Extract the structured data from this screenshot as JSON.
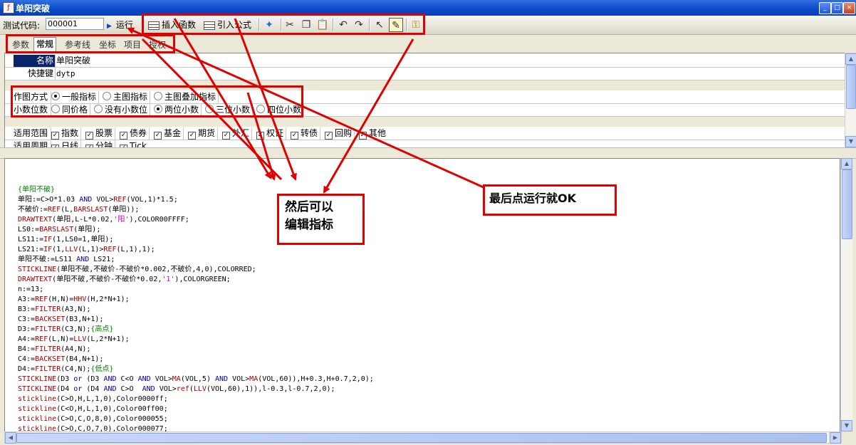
{
  "window": {
    "title": "单阳突破",
    "app_icon": "formula-icon"
  },
  "toolbar": {
    "test_code_label": "测试代码:",
    "test_code_value": "000001",
    "run_label": "运行",
    "insert_function_label": "插入函数",
    "import_formula_label": "引入公式"
  },
  "tabs": [
    "参数",
    "常规",
    "参考线",
    "坐标",
    "项目",
    "授权"
  ],
  "active_tab": "常规",
  "props": {
    "name_key": "名称",
    "name_value": "单阳突破",
    "shortcut_key": "快捷键",
    "shortcut_value": "dytp",
    "draw_mode_key": "作图方式",
    "draw_modes": [
      "一般指标",
      "主图指标",
      "主图叠加指标"
    ],
    "draw_mode_selected": "一般指标",
    "decimals_key": "小数位数",
    "decimals": [
      "同价格",
      "没有小数位",
      "两位小数",
      "三位小数",
      "四位小数"
    ],
    "decimals_selected": "两位小数",
    "scope_key": "适用范围",
    "scope_items": [
      "指数",
      "股票",
      "债券",
      "基金",
      "期货",
      "外汇",
      "权证",
      "转债",
      "回购",
      "其他"
    ],
    "period_key": "适用周期",
    "period_items": [
      "日线",
      "分钟",
      "Tick"
    ]
  },
  "code": [
    "{单阳不破}",
    "单阳:=C>O*1.03 AND VOL>REF(VOL,1)*1.5;",
    "不破价:=REF(L,BARSLAST(单阳));",
    "DRAWTEXT(单阳,L-L*0.02,'阳'),COLOR00FFFF;",
    "LS0:=BARSLAST(单阳);",
    "LS11:=IF(1,LS0=1,单阳);",
    "LS21:=IF(1,LLV(L,1)>REF(L,1),1);",
    "单阳不破:=LS11 AND LS21;",
    "STICKLINE(单阳不破,不破价-不破价*0.002,不破价,4,0),COLORRED;",
    "DRAWTEXT(单阳不破,不破价-不破价*0.02,'1'),COLORGREEN;",
    "n:=13;",
    "A3:=REF(H,N)=HHV(H,2*N+1);",
    "B3:=FILTER(A3,N);",
    "C3:=BACKSET(B3,N+1);",
    "D3:=FILTER(C3,N);{高点}",
    "A4:=REF(L,N)=LLV(L,2*N+1);",
    "B4:=FILTER(A4,N);",
    "C4:=BACKSET(B4,N+1);",
    "D4:=FILTER(C4,N);{低点}",
    "STICKLINE(D3 or (D3 AND C<O AND VOL>MA(VOL,5) AND VOL>MA(VOL,60)),H+0.3,H+0.7,2,0);",
    "STICKLINE(D4 or (D4 AND C>O  AND VOL>ref(LLV(VOL,60),1)),l-0.3,l-0.7,2,0);",
    "stickline(C>O,H,L,1,0),Color0000ff;",
    "stickline(C<O,H,L,1,0),Color00ff00;",
    "stickline(C>O,C,O,8,0),Color000055;",
    "stickline(C>O,C,O,7,0),Color000077;"
  ],
  "annotations": {
    "callout_edit": "然后可以\n编辑指标",
    "callout_run": "最后点运行就OK",
    "color": "#e00000"
  }
}
